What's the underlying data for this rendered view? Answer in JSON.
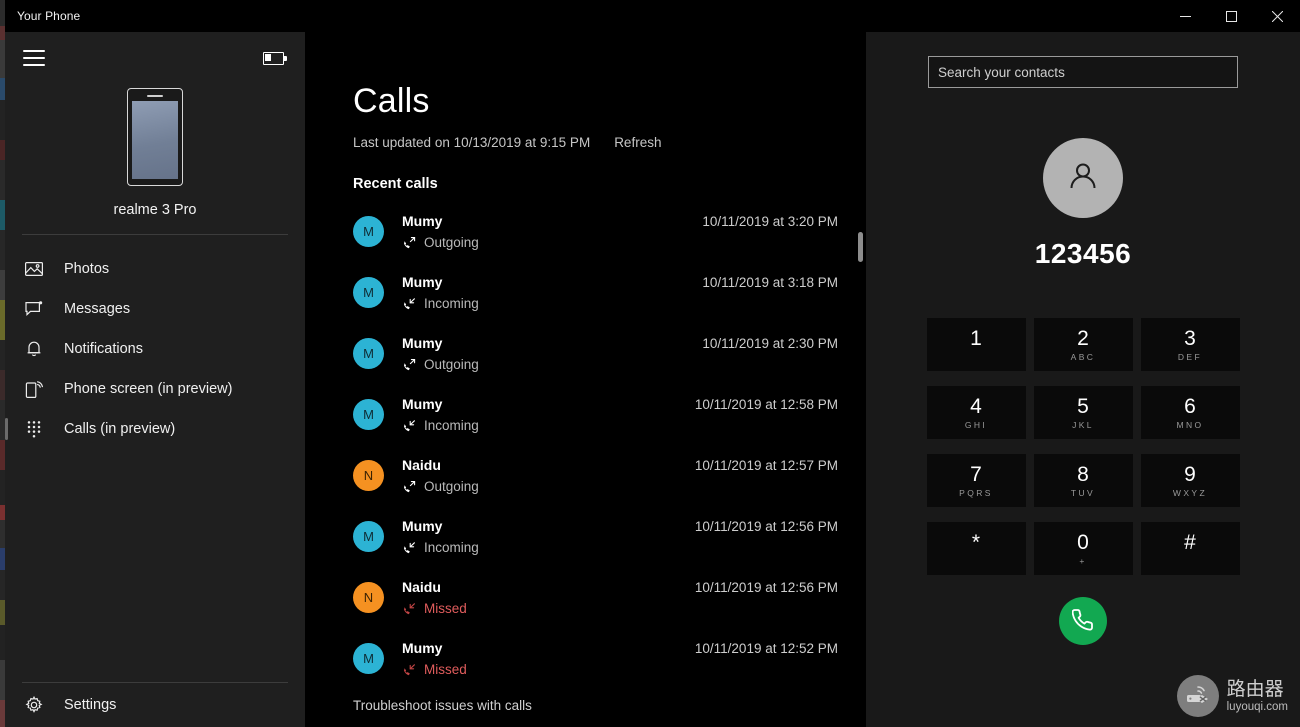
{
  "window": {
    "title": "Your Phone",
    "minimize_label": "Minimize",
    "maximize_label": "Maximize",
    "close_label": "Close"
  },
  "sidebar": {
    "menu_label": "Navigation menu",
    "battery_label": "Battery",
    "device_name": "realme 3 Pro",
    "items": [
      {
        "label": "Photos",
        "icon": "photos-icon",
        "selected": false
      },
      {
        "label": "Messages",
        "icon": "messages-icon",
        "selected": false
      },
      {
        "label": "Notifications",
        "icon": "notifications-icon",
        "selected": false
      },
      {
        "label": "Phone screen (in preview)",
        "icon": "phone-screen-icon",
        "selected": false
      },
      {
        "label": "Calls (in preview)",
        "icon": "dialpad-icon",
        "selected": true
      }
    ],
    "settings_label": "Settings",
    "settings_icon": "gear-icon"
  },
  "main": {
    "page_title": "Calls",
    "last_updated": "Last updated on 10/13/2019 at 9:15 PM",
    "refresh_label": "Refresh",
    "section_title": "Recent calls",
    "troubleshoot_label": "Troubleshoot issues with calls",
    "calls": [
      {
        "name": "Mumy",
        "initial": "M",
        "avatar_color": "#2cb3d4",
        "type": "Outgoing",
        "icon": "call-outgoing-icon",
        "time": "10/11/2019 at 3:20 PM",
        "missed": false
      },
      {
        "name": "Mumy",
        "initial": "M",
        "avatar_color": "#2cb3d4",
        "type": "Incoming",
        "icon": "call-incoming-icon",
        "time": "10/11/2019 at 3:18 PM",
        "missed": false
      },
      {
        "name": "Mumy",
        "initial": "M",
        "avatar_color": "#2cb3d4",
        "type": "Outgoing",
        "icon": "call-outgoing-icon",
        "time": "10/11/2019 at 2:30 PM",
        "missed": false
      },
      {
        "name": "Mumy",
        "initial": "M",
        "avatar_color": "#2cb3d4",
        "type": "Incoming",
        "icon": "call-incoming-icon",
        "time": "10/11/2019 at 12:58 PM",
        "missed": false
      },
      {
        "name": "Naidu",
        "initial": "N",
        "avatar_color": "#f59121",
        "type": "Outgoing",
        "icon": "call-outgoing-icon",
        "time": "10/11/2019 at 12:57 PM",
        "missed": false
      },
      {
        "name": "Mumy",
        "initial": "M",
        "avatar_color": "#2cb3d4",
        "type": "Incoming",
        "icon": "call-incoming-icon",
        "time": "10/11/2019 at 12:56 PM",
        "missed": false
      },
      {
        "name": "Naidu",
        "initial": "N",
        "avatar_color": "#f59121",
        "type": "Missed",
        "icon": "call-missed-icon",
        "time": "10/11/2019 at 12:56 PM",
        "missed": true
      },
      {
        "name": "Mumy",
        "initial": "M",
        "avatar_color": "#2cb3d4",
        "type": "Missed",
        "icon": "call-missed-icon",
        "time": "10/11/2019 at 12:52 PM",
        "missed": true
      }
    ]
  },
  "dialpanel": {
    "search_placeholder": "Search your contacts",
    "search_value": "",
    "contact_avatar_icon": "person-icon",
    "dialed_number": "123456",
    "call_button_label": "Call",
    "call_button_icon": "phone-icon",
    "keys": [
      {
        "digit": "1",
        "letters": ""
      },
      {
        "digit": "2",
        "letters": "ABC"
      },
      {
        "digit": "3",
        "letters": "DEF"
      },
      {
        "digit": "4",
        "letters": "GHI"
      },
      {
        "digit": "5",
        "letters": "JKL"
      },
      {
        "digit": "6",
        "letters": "MNO"
      },
      {
        "digit": "7",
        "letters": "PQRS"
      },
      {
        "digit": "8",
        "letters": "TUV"
      },
      {
        "digit": "9",
        "letters": "WXYZ"
      },
      {
        "digit": "*",
        "letters": ""
      },
      {
        "digit": "0",
        "letters": "+"
      },
      {
        "digit": "#",
        "letters": ""
      }
    ]
  },
  "watermark": {
    "cn": "路由器",
    "en": "luyouqi.com"
  },
  "colors": {
    "accent_green": "#12a851",
    "missed_red": "#e05c5c",
    "avatar_blue": "#2cb3d4",
    "avatar_orange": "#f59121"
  }
}
